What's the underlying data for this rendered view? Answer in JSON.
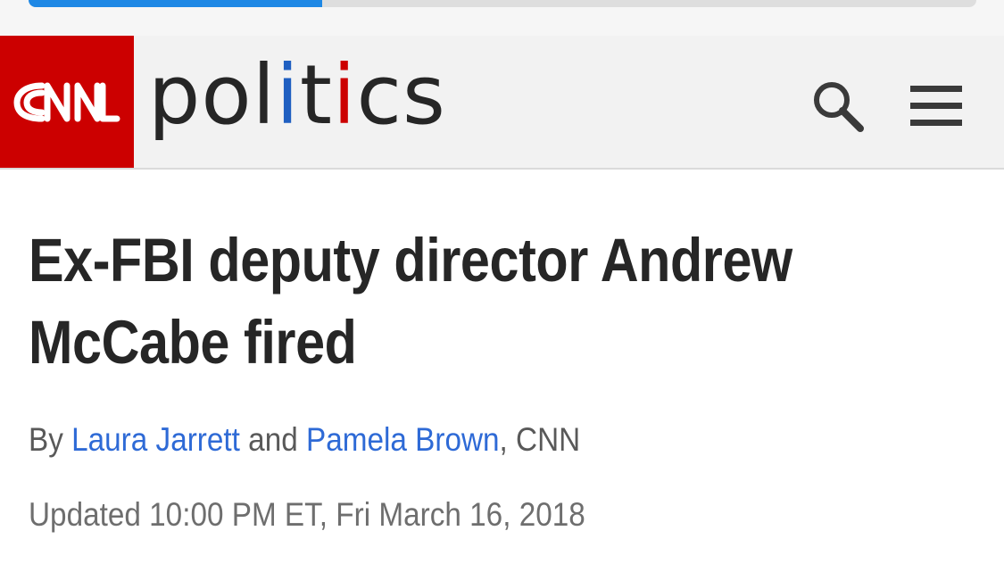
{
  "browser": {
    "load_progress": 0.31,
    "progress_color": "#1e88e5"
  },
  "header": {
    "logo_text": "CNN",
    "section_parts": [
      "pol",
      "i",
      "t",
      "i",
      "cs"
    ],
    "search_icon": "search-icon",
    "menu_icon": "hamburger-menu-icon",
    "colors": {
      "brand_red": "#cc0000",
      "accent_blue": "#1f5fc1",
      "text": "#262626"
    }
  },
  "article": {
    "headline": "Ex-FBI deputy director Andrew McCabe fired",
    "byline_prefix": "By ",
    "author_1": "Laura Jarrett",
    "byline_and": " and ",
    "author_2": "Pamela Brown",
    "byline_suffix": ", CNN",
    "updated": "Updated 10:00 PM ET, Fri March 16, 2018"
  }
}
